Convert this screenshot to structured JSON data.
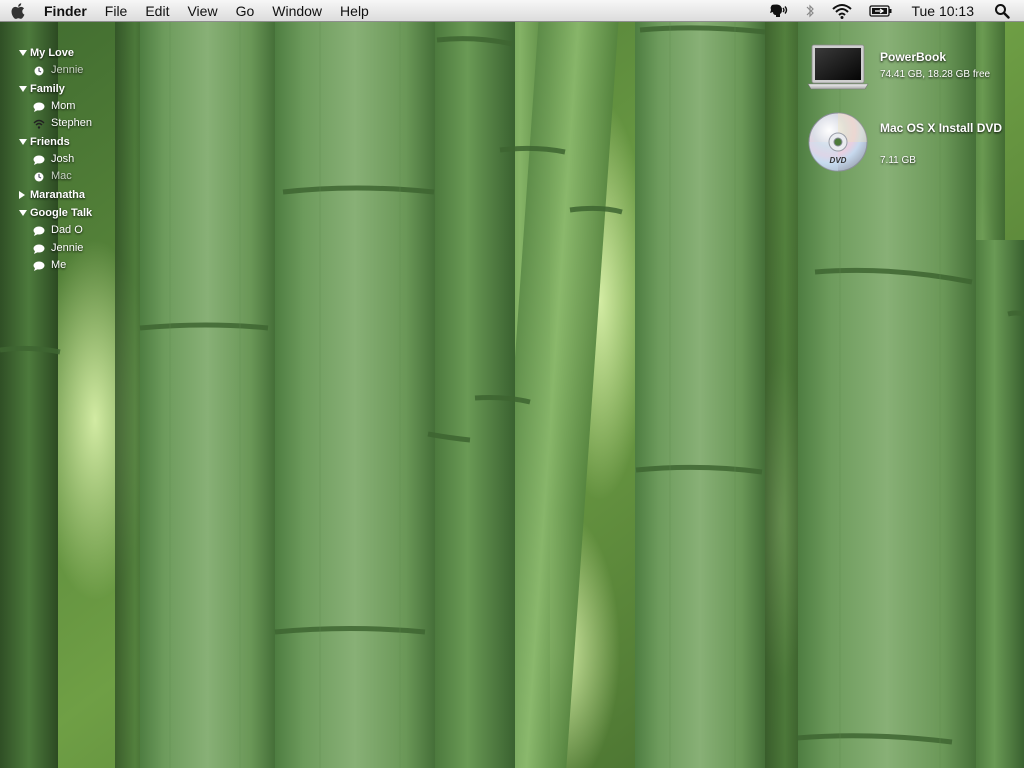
{
  "menubar": {
    "app_name": "Finder",
    "menus": [
      "File",
      "Edit",
      "View",
      "Go",
      "Window",
      "Help"
    ],
    "clock": "Tue 10:13",
    "status_icons": [
      "speech-icon",
      "bluetooth-icon",
      "wifi-icon",
      "battery-icon",
      "spotlight-icon"
    ]
  },
  "buddy_list": {
    "groups": [
      {
        "name": "My Love",
        "expanded": true,
        "buddies": [
          {
            "name": "Jennie",
            "status": "away"
          }
        ]
      },
      {
        "name": "Family",
        "expanded": true,
        "buddies": [
          {
            "name": "Mom",
            "status": "available"
          },
          {
            "name": "Stephen",
            "status": "wifi"
          }
        ]
      },
      {
        "name": "Friends",
        "expanded": true,
        "buddies": [
          {
            "name": "Josh",
            "status": "available"
          },
          {
            "name": "Mac",
            "status": "away"
          }
        ]
      },
      {
        "name": "Maranatha",
        "expanded": false,
        "buddies": []
      },
      {
        "name": "Google Talk",
        "expanded": true,
        "buddies": [
          {
            "name": "Dad O",
            "status": "available"
          },
          {
            "name": "Jennie",
            "status": "available"
          },
          {
            "name": "Me",
            "status": "available"
          }
        ]
      }
    ]
  },
  "desktop": {
    "disks": [
      {
        "name": "PowerBook",
        "info": "74.41 GB, 18.28 GB free",
        "icon": "laptop-icon"
      },
      {
        "name": "Mac OS X Install DVD",
        "info": "7.11 GB",
        "icon": "dvd-icon"
      }
    ]
  },
  "colors": {
    "menubar_bg": "#e8e8e8",
    "wallpaper_green": "#6f9a55"
  }
}
